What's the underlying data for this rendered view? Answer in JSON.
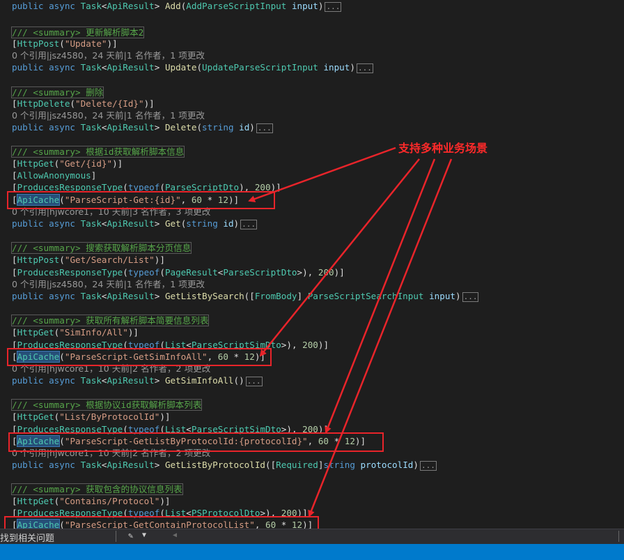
{
  "code": {
    "top_line": "public async Task<ApiResult> Add(AddParseScriptInput input)",
    "blocks": [
      {
        "summary": "/// <summary> 更新解析脚本2",
        "attrs": [
          "[HttpPost(\"Update\")]"
        ],
        "lens": "0 个引用|jsz4580，24 天前|1 名作者，1 项更改",
        "signature": "public async Task<ApiResult> Update(UpdateParseScriptInput input)"
      },
      {
        "summary": "/// <summary> 删除",
        "attrs": [
          "[HttpDelete(\"Delete/{Id}\")]"
        ],
        "lens": "0 个引用|jsz4580，24 天前|1 名作者，1 项更改",
        "signature": "public async Task<ApiResult> Delete(string id)"
      },
      {
        "summary": "/// <summary> 根据id获取解析脚本信息",
        "attrs": [
          "[HttpGet(\"Get/{id}\")]",
          "[AllowAnonymous]",
          "[ProducesResponseType(typeof(ParseScriptDto), 200)]"
        ],
        "cache": "[ApiCache(\"ParseScript-Get:{id}\", 60 * 12)]",
        "lens": "0 个引用|hjwcore1，10 天前|3 名作者，3 项更改",
        "signature": "public async Task<ApiResult> Get(string id)"
      },
      {
        "summary": "/// <summary> 搜索获取解析脚本分页信息",
        "attrs": [
          "[HttpPost(\"Get/Search/List\")]",
          "[ProducesResponseType(typeof(PageResult<ParseScriptDto>), 200)]"
        ],
        "lens": "0 个引用|jsz4580，24 天前|1 名作者，1 项更改",
        "signature": "public async Task<ApiResult> GetListBySearch([FromBody] ParseScriptSearchInput input)"
      },
      {
        "summary": "/// <summary> 获取所有解析脚本简要信息列表",
        "attrs": [
          "[HttpGet(\"SimInfo/All\")]",
          "[ProducesResponseType(typeof(List<ParseScriptSimDto>), 200)]"
        ],
        "cache": "[ApiCache(\"ParseScript-GetSimInfoAll\", 60 * 12)]",
        "lens": "0 个引用|hjwcore1，10 天前|2 名作者，2 项更改",
        "signature": "public async Task<ApiResult> GetSimInfoAll()"
      },
      {
        "summary": "/// <summary> 根据协议id获取解析脚本列表",
        "attrs": [
          "[HttpGet(\"List/ByProtocolId\")]",
          "[ProducesResponseType(typeof(List<ParseScriptSimDto>), 200)]"
        ],
        "cache": "[ApiCache(\"ParseScript-GetListByProtocolId:{protocolId}\", 60 * 12)]",
        "lens": "0 个引用|hjwcore1，10 天前|2 名作者，2 项更改",
        "signature": "public async Task<ApiResult> GetListByProtocolId([Required]string protocolId)"
      },
      {
        "summary": "/// <summary> 获取包含的协议信息列表",
        "attrs": [
          "[HttpGet(\"Contains/Protocol\")]",
          "[ProducesResponseType(typeof(List<PSProtocolDto>), 200)]"
        ],
        "cache": "[ApiCache(\"ParseScript-GetContainProtocolList\", 60 * 12)]"
      }
    ],
    "ellipsis": "..."
  },
  "annotation": {
    "label": "支持多种业务场景",
    "color": "#e8242a"
  },
  "status_bar": {
    "text": "找到相关问题"
  },
  "colors": {
    "editor_bg": "#1e1e1e",
    "status_blue": "#007acc"
  }
}
